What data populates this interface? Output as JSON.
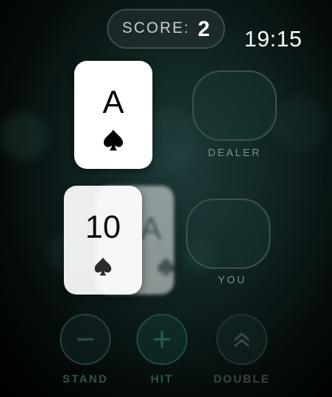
{
  "status": {
    "time": "19:15"
  },
  "score": {
    "label": "SCORE:",
    "value": "2"
  },
  "dealer": {
    "card": {
      "rank": "A",
      "suit": "spade"
    },
    "label": "DEALER"
  },
  "player": {
    "card": {
      "rank": "10",
      "suit": "spade"
    },
    "ghost_card": {
      "rank": "A",
      "suit": "spade"
    },
    "label": "YOU"
  },
  "controls": [
    {
      "label": "STAND",
      "icon": "minus-icon"
    },
    {
      "label": "HIT",
      "icon": "plus-icon"
    },
    {
      "label": "DOUBLE",
      "icon": "double-chevron-up-icon"
    }
  ]
}
